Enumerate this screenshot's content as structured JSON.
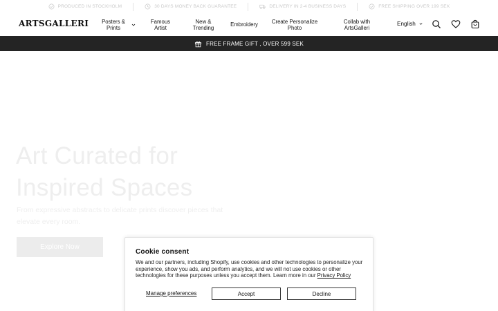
{
  "usp_bar": {
    "items": [
      {
        "label": "PRODUCED IN STOCKHOLM",
        "icon": "shield-check-icon"
      },
      {
        "label": "30 DAYS MONEY BACK GUARANTEE",
        "icon": "refund-icon"
      },
      {
        "label": "DELIVERY IN 2-4 BUSINESS DAYS",
        "icon": "truck-icon"
      },
      {
        "label": "FREE SHIPPING OVER 199 SEK",
        "icon": "shipping-icon"
      }
    ]
  },
  "header": {
    "logo": "ARTSGALLERI",
    "nav": [
      {
        "label": "Posters & Prints",
        "has_dropdown": true
      },
      {
        "label": "Famous Artist"
      },
      {
        "label": "New & Trending"
      },
      {
        "label": "Embroidery"
      },
      {
        "label": "Create Personalize Photo"
      },
      {
        "label": "Collab with ArtsGalleri"
      }
    ],
    "language": "English",
    "icons": [
      "search-icon",
      "heart-icon",
      "cart-icon"
    ]
  },
  "promo": {
    "text": "FREE FRAME GIFT , OVER 599 SEK",
    "icon": "gift-icon"
  },
  "hero": {
    "title_line1": "Art Curated for",
    "title_line2": "Inspired Spaces",
    "subtitle": "From expressive abstracts to delicate prints discover pieces that elevate every room.",
    "button": "Explore Now"
  },
  "cookie": {
    "title": "Cookie consent",
    "text": "We and our partners, including Shopify, use cookies and other technologies to personalize your experience, show you ads, and perform analytics, and we will not use cookies or other technologies for these purposes unless you accept them. Learn more in our",
    "link": "Privacy Policy",
    "manage": "Manage preferences",
    "accept": "Accept",
    "decline": "Decline"
  },
  "colors": {
    "promo_bg": "#242424",
    "hero_text": "#eeeeee",
    "logo_accent": "#c0392b"
  }
}
